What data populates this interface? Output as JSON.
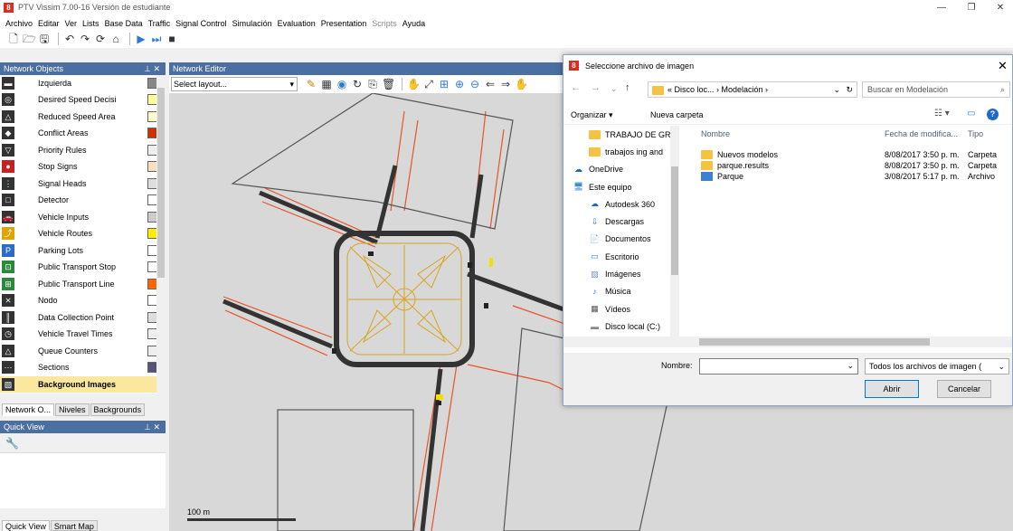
{
  "app": {
    "title": "PTV Vissim 7.00-16 Versión de estudiante",
    "logo_text": "8"
  },
  "window_controls": {
    "minimize": "—",
    "maximize": "❐",
    "close": "✕"
  },
  "menu": [
    {
      "label": "Archivo",
      "enabled": true
    },
    {
      "label": "Editar",
      "enabled": true
    },
    {
      "label": "Ver",
      "enabled": true
    },
    {
      "label": "Lists",
      "enabled": true
    },
    {
      "label": "Base Data",
      "enabled": true
    },
    {
      "label": "Traffic",
      "enabled": true
    },
    {
      "label": "Signal Control",
      "enabled": true
    },
    {
      "label": "Simulación",
      "enabled": true
    },
    {
      "label": "Evaluation",
      "enabled": true
    },
    {
      "label": "Presentation",
      "enabled": true
    },
    {
      "label": "Scripts",
      "enabled": false
    },
    {
      "label": "Ayuda",
      "enabled": true
    }
  ],
  "network_objects": {
    "header": "Network Objects",
    "items": [
      {
        "label": "Izquierda",
        "icon": "link-icon",
        "swatch": "#888888"
      },
      {
        "label": "Desired Speed Decisi",
        "icon": "speed-icon",
        "swatch": "#ffff99"
      },
      {
        "label": "Reduced Speed Area",
        "icon": "warning-icon",
        "swatch": "#ffffcc"
      },
      {
        "label": "Conflict Areas",
        "icon": "conflict-icon",
        "swatch": "#cc3300"
      },
      {
        "label": "Priority Rules",
        "icon": "priority-icon",
        "swatch": "#eeeeee"
      },
      {
        "label": "Stop Signs",
        "icon": "stop-icon",
        "swatch": "#f5e0c0"
      },
      {
        "label": "Signal Heads",
        "icon": "traffic-light-icon",
        "swatch": "#dddddd"
      },
      {
        "label": "Detector",
        "icon": "detector-icon",
        "swatch": "#ffffff"
      },
      {
        "label": "Vehicle Inputs",
        "icon": "car-icon",
        "swatch": "#cccccc"
      },
      {
        "label": "Vehicle Routes",
        "icon": "route-icon",
        "swatch": "#ffee00"
      },
      {
        "label": "Parking Lots",
        "icon": "parking-icon",
        "swatch": "#ffffff"
      },
      {
        "label": "Public Transport Stop",
        "icon": "bus-stop-icon",
        "swatch": "#ffffff"
      },
      {
        "label": "Public Transport Line",
        "icon": "bus-line-icon",
        "swatch": "#ff6600"
      },
      {
        "label": "Nodo",
        "icon": "node-icon",
        "swatch": "#ffffff"
      },
      {
        "label": "Data Collection Point",
        "icon": "data-point-icon",
        "swatch": "#dddddd"
      },
      {
        "label": "Vehicle Travel Times",
        "icon": "timer-icon",
        "swatch": "#eeeeee"
      },
      {
        "label": "Queue Counters",
        "icon": "queue-icon",
        "swatch": "#eeeeee"
      },
      {
        "label": "Sections",
        "icon": "section-icon",
        "swatch": "#555577"
      },
      {
        "label": "Background Images",
        "icon": "image-icon",
        "swatch": "",
        "selected": true
      }
    ]
  },
  "left_tabs": [
    "Network O...",
    "Niveles",
    "Backgrounds"
  ],
  "quick_view": {
    "header": "Quick View"
  },
  "bottom_tabs": [
    "Quick View",
    "Smart Map"
  ],
  "network_editor": {
    "header": "Network Editor",
    "layout_select": "Select layout...",
    "scale_label": "100 m"
  },
  "dialog": {
    "title": "Seleccione archivo de imagen",
    "address_path": "« Disco loc... › Modelación ›",
    "search_placeholder": "Buscar en Modelación",
    "organize_label": "Organizar ▾",
    "new_folder_label": "Nueva carpeta",
    "tree": [
      {
        "label": "TRABAJO DE GR",
        "type": "folder"
      },
      {
        "label": "trabajos ing and",
        "type": "folder"
      },
      {
        "label": "OneDrive",
        "type": "cloud"
      },
      {
        "label": "Este equipo",
        "type": "pc"
      },
      {
        "label": "Autodesk 360",
        "type": "cloud"
      },
      {
        "label": "Descargas",
        "type": "download"
      },
      {
        "label": "Documentos",
        "type": "doc"
      },
      {
        "label": "Escritorio",
        "type": "desktop"
      },
      {
        "label": "Imágenes",
        "type": "image"
      },
      {
        "label": "Música",
        "type": "music"
      },
      {
        "label": "Vídeos",
        "type": "video"
      },
      {
        "label": "Disco local (C:)",
        "type": "drive"
      }
    ],
    "columns": [
      "Nombre",
      "Fecha de modifica...",
      "Tipo"
    ],
    "files": [
      {
        "name": "Nuevos modelos",
        "date": "8/08/2017 3:50 p. m.",
        "type": "Carpeta",
        "kind": "folder"
      },
      {
        "name": "parque.results",
        "date": "8/08/2017 3:50 p. m.",
        "type": "Carpeta",
        "kind": "folder"
      },
      {
        "name": "Parque",
        "date": "3/08/2017 5:17 p. m.",
        "type": "Archivo",
        "kind": "vissim"
      }
    ],
    "name_label": "Nombre:",
    "name_value": "",
    "filter_value": "Todos los archivos de imagen (",
    "open_label": "Abrir",
    "cancel_label": "Cancelar"
  }
}
